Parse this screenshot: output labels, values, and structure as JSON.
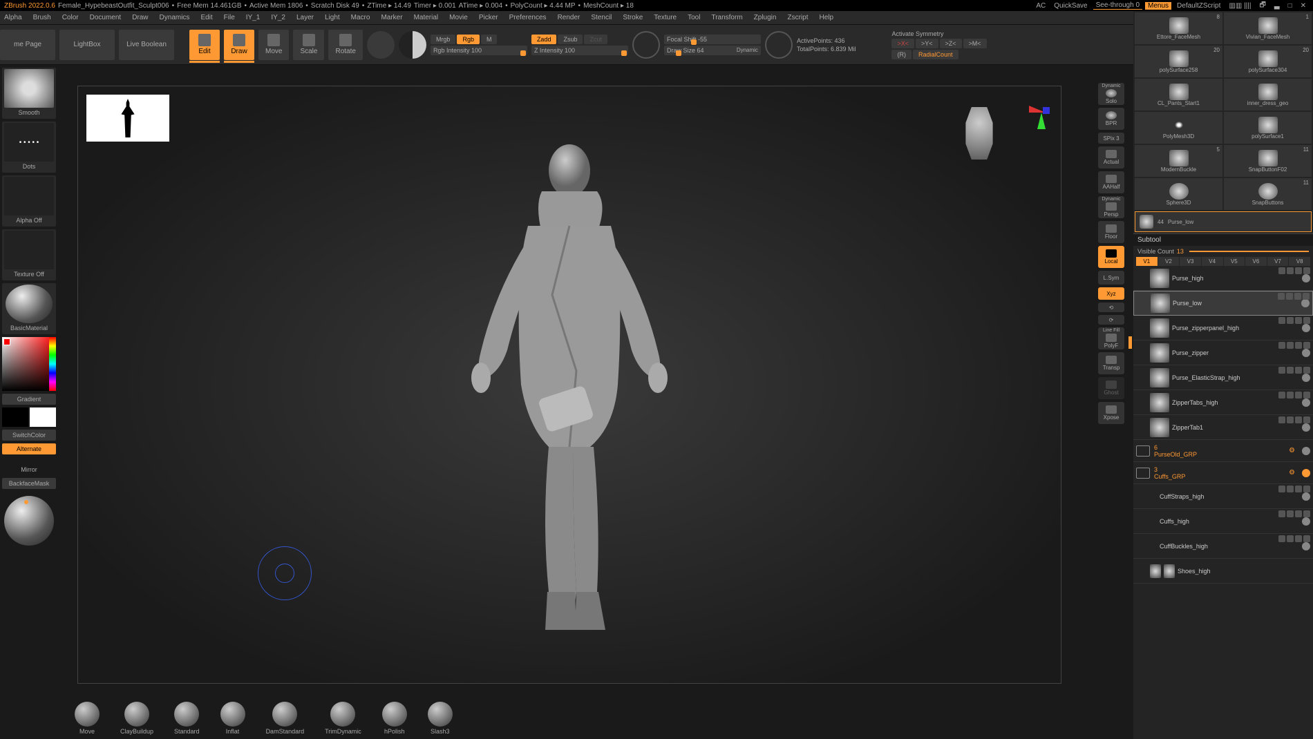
{
  "title": {
    "app": "ZBrush 2022.0.6",
    "project": "Female_HypebeastOutfit_Sculpt006",
    "freemem": "Free Mem 14.461GB",
    "activemem": "Active Mem 1806",
    "scratch": "Scratch Disk 49",
    "ztime": "ZTime ▸ 14.49",
    "timer": "Timer ▸ 0.001",
    "atime": "ATime ▸ 0.004",
    "polycount": "PolyCount ▸ 4.44 MP",
    "meshcount": "MeshCount ▸ 18",
    "ac": "AC",
    "quicksave": "QuickSave",
    "seethrough": "See-through  0",
    "menus": "Menus",
    "defscript": "DefaultZScript"
  },
  "menus": [
    "Alpha",
    "Brush",
    "Color",
    "Document",
    "Draw",
    "Dynamics",
    "Edit",
    "File",
    "IY_1",
    "IY_2",
    "Layer",
    "Light",
    "Macro",
    "Marker",
    "Material",
    "Movie",
    "Picker",
    "Preferences",
    "Render",
    "Stencil",
    "Stroke",
    "Texture",
    "Tool",
    "Transform",
    "Zplugin",
    "Zscript",
    "Help"
  ],
  "toolbar": {
    "homepage": "me Page",
    "lightbox": "LightBox",
    "liveboolean": "Live Boolean",
    "edit": "Edit",
    "draw": "Draw",
    "move": "Move",
    "scale": "Scale",
    "rotate": "Rotate",
    "mrgb": "Mrgb",
    "rgb": "Rgb",
    "m": "M",
    "rgbint": "Rgb Intensity 100",
    "zadd": "Zadd",
    "zsub": "Zsub",
    "zcut": "Zcut",
    "zint": "Z Intensity 100",
    "focal": "Focal Shift -55",
    "drawsize": "Draw Size 64",
    "dynamic": "Dynamic",
    "activepoints": "ActivePoints: 436",
    "totalpoints": "TotalPoints: 6.839 Mil",
    "activatesym": "Activate Symmetry",
    "xsym": ">X<",
    "ysym": ">Y<",
    "zsym": ">Z<",
    "msym": ">M<",
    "r": "(R)",
    "radial": "RadialCount"
  },
  "left": {
    "brush": "Smooth",
    "stroke": "Dots",
    "alpha": "Alpha Off",
    "texture": "Texture Off",
    "material": "BasicMaterial",
    "gradient": "Gradient",
    "switchcolor": "SwitchColor",
    "alternate": "Alternate",
    "mirror": "Mirror",
    "backface": "BackfaceMask"
  },
  "rightbtns": {
    "dynamic": "Dynamic",
    "solo": "Solo",
    "bpr": "BPR",
    "spix": "SPix 3",
    "actual": "Actual",
    "aahalf": "AAHalf",
    "persp": "Persp",
    "floor": "Floor",
    "local": "Local",
    "lsym": "L.Sym",
    "xyz": "Xyz",
    "linefill": "Line Fill",
    "polyf": "PolyF",
    "transp": "Transp",
    "ghost": "Ghost",
    "xpose": "Xpose"
  },
  "tools": [
    {
      "name": "Ettore_FaceMesh",
      "count": "8"
    },
    {
      "name": "Vivian_FaceMesh",
      "count": "1"
    },
    {
      "name": "polySurface258",
      "count": "20"
    },
    {
      "name": "polySurface304",
      "count": "20"
    },
    {
      "name": "CL_Pants_Start1",
      "count": ""
    },
    {
      "name": "inner_dress_geo",
      "count": ""
    },
    {
      "name": "PolyMesh3D",
      "count": ""
    },
    {
      "name": "polySurface1",
      "count": ""
    },
    {
      "name": "ModernBuckle",
      "count": "5"
    },
    {
      "name": "SnapButtonF02",
      "count": "11"
    },
    {
      "name": "Sphere3D",
      "count": ""
    },
    {
      "name": "SnapButtons",
      "count": "11"
    },
    {
      "name": "Purse_low",
      "count": "44"
    }
  ],
  "subtool": {
    "header": "Subtool",
    "visible": "Visible Count",
    "visiblecount": "13",
    "vtabs": [
      "V1",
      "V2",
      "V3",
      "V4",
      "V5",
      "V6",
      "V7",
      "V8"
    ],
    "items": [
      {
        "name": "Purse_high"
      },
      {
        "name": "Purse_low",
        "sel": true
      },
      {
        "name": "Purse_zipperpanel_high"
      },
      {
        "name": "Purse_zipper"
      },
      {
        "name": "Purse_ElasticStrap_high"
      },
      {
        "name": "ZipperTabs_high"
      },
      {
        "name": "ZipperTab1"
      }
    ],
    "folders": [
      {
        "name": "PurseOld_GRP",
        "count": "6"
      },
      {
        "name": "Cuffs_GRP",
        "count": "3"
      }
    ],
    "after": [
      {
        "name": "CuffStraps_high"
      },
      {
        "name": "Cuffs_high"
      },
      {
        "name": "CuffBuckles_high"
      },
      {
        "name": "Shoes_high"
      }
    ]
  },
  "brushes": [
    "Move",
    "ClayBuildup",
    "Standard",
    "Inflat",
    "DamStandard",
    "TrimDynamic",
    "hPolish",
    "Slash3"
  ]
}
